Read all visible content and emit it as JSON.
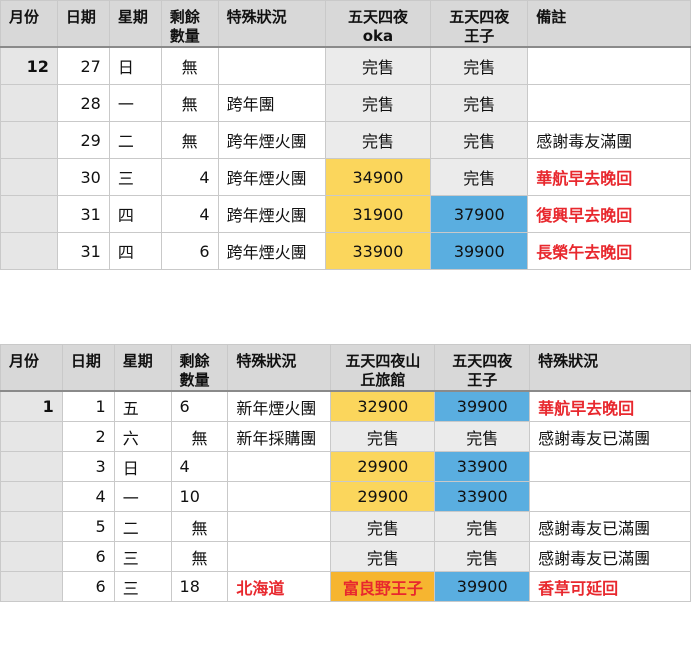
{
  "table1": {
    "headers": [
      "月份",
      "日期",
      "星期",
      "剩餘\n數量",
      "特殊狀況",
      "五天四夜\noka",
      "五天四夜\n王子",
      "備註"
    ],
    "rows": [
      {
        "month": "12",
        "date": "27",
        "weekday": "日",
        "remaining": "無",
        "special": "",
        "p1": "完售",
        "p1_style": "sold",
        "p2": "完售",
        "p2_style": "sold",
        "note": "",
        "note_style": ""
      },
      {
        "month": "",
        "date": "28",
        "weekday": "一",
        "remaining": "無",
        "special": "跨年團",
        "p1": "完售",
        "p1_style": "sold",
        "p2": "完售",
        "p2_style": "sold",
        "note": "",
        "note_style": ""
      },
      {
        "month": "",
        "date": "29",
        "weekday": "二",
        "remaining": "無",
        "special": "跨年煙火團",
        "p1": "完售",
        "p1_style": "sold",
        "p2": "完售",
        "p2_style": "sold",
        "note": "感謝毒友滿團",
        "note_style": ""
      },
      {
        "month": "",
        "date": "30",
        "weekday": "三",
        "remaining": "4",
        "special": "跨年煙火團",
        "p1": "34900",
        "p1_style": "yellow",
        "p2": "完售",
        "p2_style": "sold",
        "note": "華航早去晚回",
        "note_style": "red"
      },
      {
        "month": "",
        "date": "31",
        "weekday": "四",
        "remaining": "4",
        "special": "跨年煙火團",
        "p1": "31900",
        "p1_style": "yellow",
        "p2": "37900",
        "p2_style": "blue",
        "note": "復興早去晚回",
        "note_style": "red"
      },
      {
        "month": "",
        "date": "31",
        "weekday": "四",
        "remaining": "6",
        "special": "跨年煙火團",
        "p1": "33900",
        "p1_style": "yellow",
        "p2": "39900",
        "p2_style": "blue",
        "note": "長榮午去晚回",
        "note_style": "red"
      }
    ]
  },
  "table2": {
    "headers": [
      "月份",
      "日期",
      "星期",
      "剩餘\n數量",
      "特殊狀況",
      "五天四夜山\n丘旅館",
      "五天四夜\n王子",
      "特殊狀況"
    ],
    "rows": [
      {
        "month": "1",
        "date": "1",
        "weekday": "五",
        "remaining": "6",
        "special": "新年煙火團",
        "special_style": "",
        "p1": "32900",
        "p1_style": "yellow",
        "p2": "39900",
        "p2_style": "blue",
        "note": "華航早去晚回",
        "note_style": "red"
      },
      {
        "month": "",
        "date": "2",
        "weekday": "六",
        "remaining": "無",
        "special": "新年採購團",
        "special_style": "",
        "p1": "完售",
        "p1_style": "sold",
        "p2": "完售",
        "p2_style": "sold",
        "note": "感謝毒友已滿團",
        "note_style": ""
      },
      {
        "month": "",
        "date": "3",
        "weekday": "日",
        "remaining": "4",
        "special": "",
        "special_style": "",
        "p1": "29900",
        "p1_style": "yellow",
        "p2": "33900",
        "p2_style": "blue",
        "note": "",
        "note_style": ""
      },
      {
        "month": "",
        "date": "4",
        "weekday": "一",
        "remaining": "10",
        "special": "",
        "special_style": "",
        "p1": "29900",
        "p1_style": "yellow",
        "p2": "33900",
        "p2_style": "blue",
        "note": "",
        "note_style": ""
      },
      {
        "month": "",
        "date": "5",
        "weekday": "二",
        "remaining": "無",
        "special": "",
        "special_style": "",
        "p1": "完售",
        "p1_style": "sold",
        "p2": "完售",
        "p2_style": "sold",
        "note": "感謝毒友已滿團",
        "note_style": ""
      },
      {
        "month": "",
        "date": "6",
        "weekday": "三",
        "remaining": "無",
        "special": "",
        "special_style": "",
        "p1": "完售",
        "p1_style": "sold",
        "p2": "完售",
        "p2_style": "sold",
        "note": "感謝毒友已滿團",
        "note_style": ""
      },
      {
        "month": "",
        "date": "6",
        "weekday": "三",
        "remaining": "18",
        "special": "北海道",
        "special_style": "red",
        "p1": "富良野王子",
        "p1_style": "orange",
        "p2": "39900",
        "p2_style": "blue",
        "note": "香草可延回",
        "note_style": "red"
      }
    ]
  }
}
